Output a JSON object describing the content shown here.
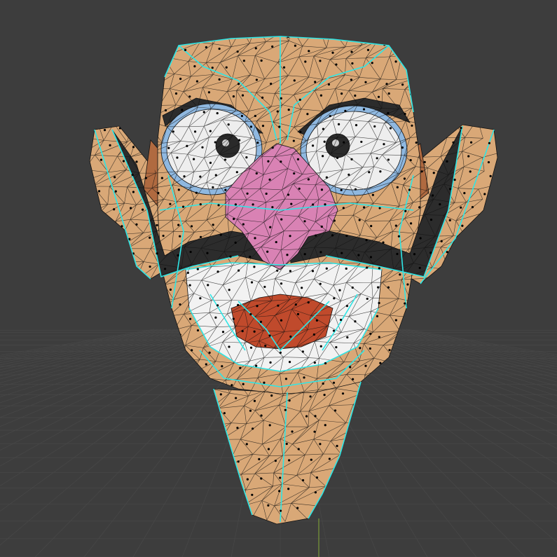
{
  "viewport": {
    "mode": "edit-mode",
    "view": "front-orthographic",
    "background_color": "#3d3d3d",
    "grid_color": "#474747",
    "y_axis_color": "#7a9a3a",
    "wire_color": "#111111",
    "selected_edge_color": "#2ee6e6",
    "vertex_color": "#000000"
  },
  "model": {
    "skin_color": "#d9a877",
    "skin_shadow_color": "#b8875a",
    "eye_white_color": "#eeeeee",
    "eye_rim_color": "#8fb8e0",
    "pupil_color": "#2a2a2a",
    "nose_color": "#d982b4",
    "mustache_color": "#2c2c2c",
    "brow_color": "#2c2c2c",
    "teeth_color": "#f2f2f2",
    "mouth_color": "#c04a2c",
    "ear_inner_color": "#b06a40"
  }
}
